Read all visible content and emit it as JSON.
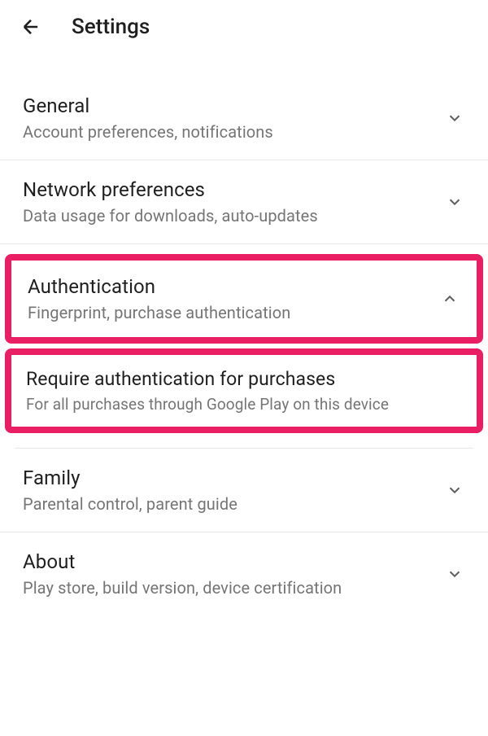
{
  "header": {
    "title": "Settings"
  },
  "sections": {
    "general": {
      "title": "General",
      "subtitle": "Account preferences, notifications"
    },
    "network": {
      "title": "Network preferences",
      "subtitle": "Data usage for downloads, auto-updates"
    },
    "authentication": {
      "title": "Authentication",
      "subtitle": "Fingerprint, purchase authentication"
    },
    "require_auth": {
      "title": "Require authentication for purchases",
      "subtitle": "For all purchases through Google Play on this device"
    },
    "family": {
      "title": "Family",
      "subtitle": "Parental control, parent guide"
    },
    "about": {
      "title": "About",
      "subtitle": "Play store, build version, device certification"
    }
  }
}
